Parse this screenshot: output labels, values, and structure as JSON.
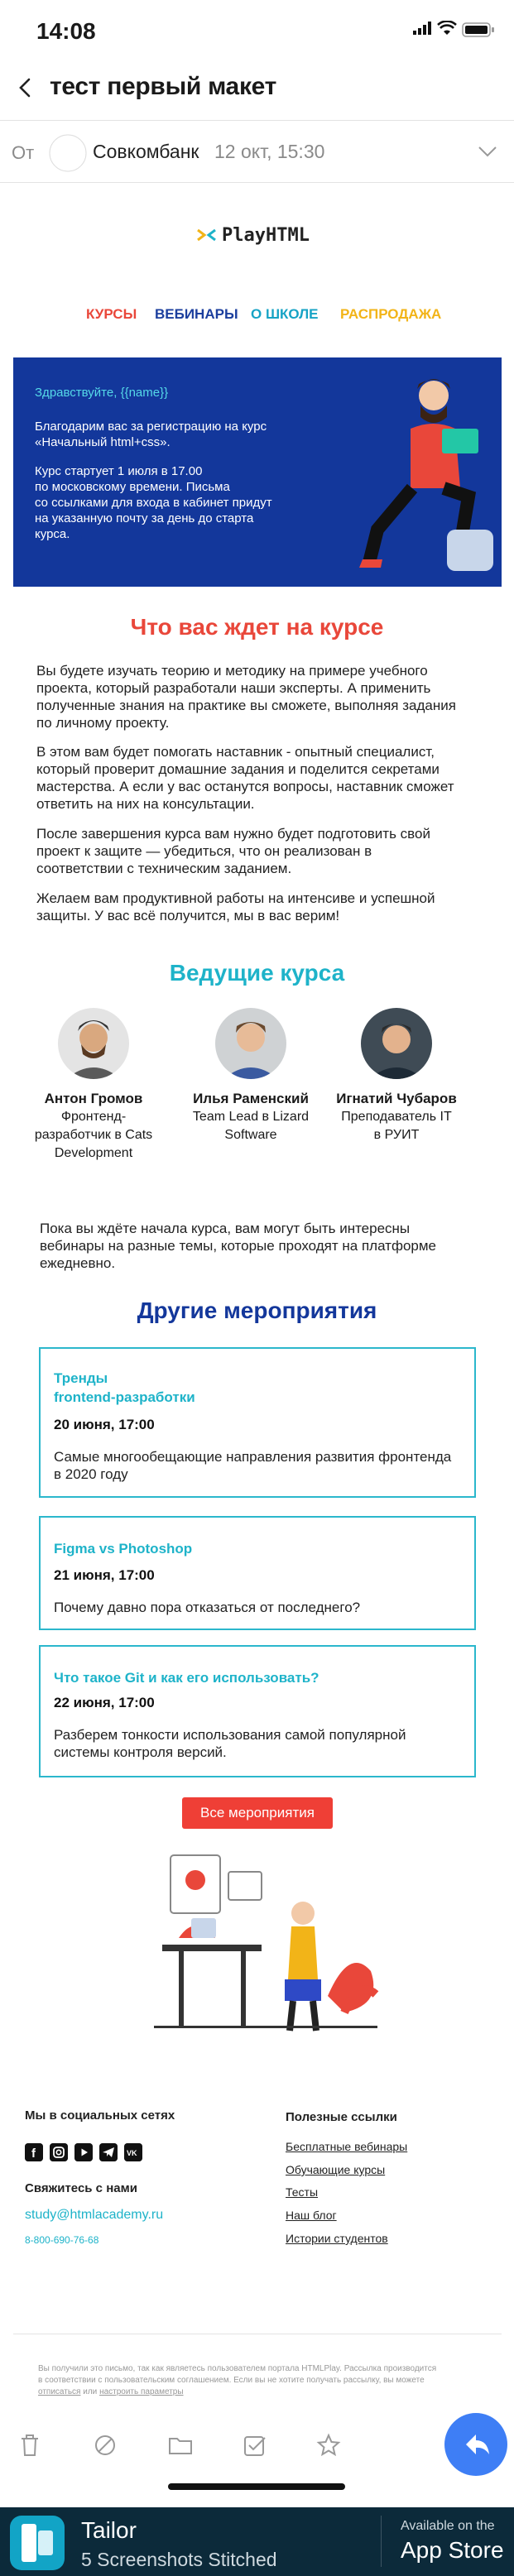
{
  "status_bar": {
    "time": "14:08"
  },
  "header": {
    "subject": "тест первый макет"
  },
  "from": {
    "label": "От",
    "sender": "Совкомбанк",
    "date": "12 окт, 15:30"
  },
  "email": {
    "brand": "PlayHTML",
    "nav": [
      {
        "label": "КУРСЫ",
        "color": "#e9473a"
      },
      {
        "label": "ВЕБИНАРЫ",
        "color": "#1c3f9e"
      },
      {
        "label": "О ШКОЛЕ",
        "color": "#16a3c5"
      },
      {
        "label": "РАСПРОДАЖА",
        "color": "#f2b418"
      }
    ],
    "hero": {
      "greeting": "Здравствуйте, {{name}}",
      "p1_l1": "Благодарим вас за регистрацию на курс",
      "p1_l2": "«Начальный html+css».",
      "p2_l1": "Курс стартует 1 июля в 17.00",
      "p2_l2": "по московскому времени. Письма",
      "p2_l3": "со ссылками для входа в кабинет придут",
      "p2_l4": "на указанную почту за день до старта",
      "p2_l5": "курса."
    },
    "course": {
      "title": "Что вас ждет на курсе",
      "p1_l1": "Вы будете изучать теорию и методику на примере учебного",
      "p1_l2": "проекта, который разработали наши эксперты. А применить",
      "p1_l3": "полученные знания на практике вы сможете, выполняя задания",
      "p1_l4": "по личному проекту.",
      "p2_l1": "В этом вам будет помогать наставник - опытный специалист,",
      "p2_l2": "который проверит домашние задания и поделится секретами",
      "p2_l3": "мастерства. А если у вас останутся вопросы, наставник сможет",
      "p2_l4": "ответить на них на консультации.",
      "p3_l1": "После завершения курса вам нужно будет подготовить свой",
      "p3_l2": "проект к защите — убедиться, что он реализован в",
      "p3_l3": "соответствии с техническим заданием.",
      "p4_l1": "Желаем вам продуктивной работы на интенсиве и успешной",
      "p4_l2": "защиты. У вас всё получится, мы в вас верим!"
    },
    "mentors": {
      "title": "Ведущие курса",
      "items": [
        {
          "name": "Антон Громов",
          "r1": "Фронтенд-",
          "r2": "разработчик в Cats",
          "r3": "Development"
        },
        {
          "name": "Илья Раменский",
          "r1": "Team Lead в Lizard",
          "r2": "Software",
          "r3": ""
        },
        {
          "name": "Игнатий Чубаров",
          "r1": "Преподаватель IT",
          "r2": "в РУИТ",
          "r3": ""
        }
      ]
    },
    "intro_l1": "Пока вы ждёте начала курса, вам могут быть интересны",
    "intro_l2": "вебинары на разные темы, которые проходят на платформе",
    "intro_l3": "ежедневно.",
    "events": {
      "title": "Другие мероприятия",
      "items": [
        {
          "t1": "Тренды",
          "t2": "frontend-разработки",
          "date": "20 июня, 17:00",
          "d1": "Самые многообещающие направления развития фронтенда",
          "d2": "в 2020 году"
        },
        {
          "t1": "Figma vs Photoshop",
          "t2": "",
          "date": "21 июня, 17:00",
          "d1": "Почему давно пора отказаться от последнего?",
          "d2": ""
        },
        {
          "t1": "Что такое Git и как его использовать?",
          "t2": "",
          "date": "22 июня, 17:00",
          "d1": "Разберем тонкости использования самой популярной",
          "d2": "системы контроля версий."
        }
      ],
      "all_button": "Все мероприятия"
    },
    "footer": {
      "social_title": "Мы в социальных сетях",
      "contact_title": "Свяжитесь с нами",
      "email": "study@htmlacademy.ru",
      "phone": "8-800-690-76-68",
      "links_title": "Полезные ссылки",
      "links": [
        "Бесплатные вебинары",
        "Обучающие курсы",
        "Тесты",
        "Наш блог",
        "Истории студентов"
      ],
      "fine_l1": "Вы получили это письмо, так как являетесь пользователем портала HTMLPlay. Рассылка производится",
      "fine_l2": "в соответствии с пользовательским соглашением. Если вы не хотите получать рассылку, вы можете",
      "fine_unsub": "отписаться",
      "fine_or": " или ",
      "fine_settings": "настроить параметры"
    }
  },
  "banner": {
    "title": "Tailor",
    "subtitle": "5 Screenshots Stitched",
    "avail": "Available on the",
    "store": "App Store"
  }
}
